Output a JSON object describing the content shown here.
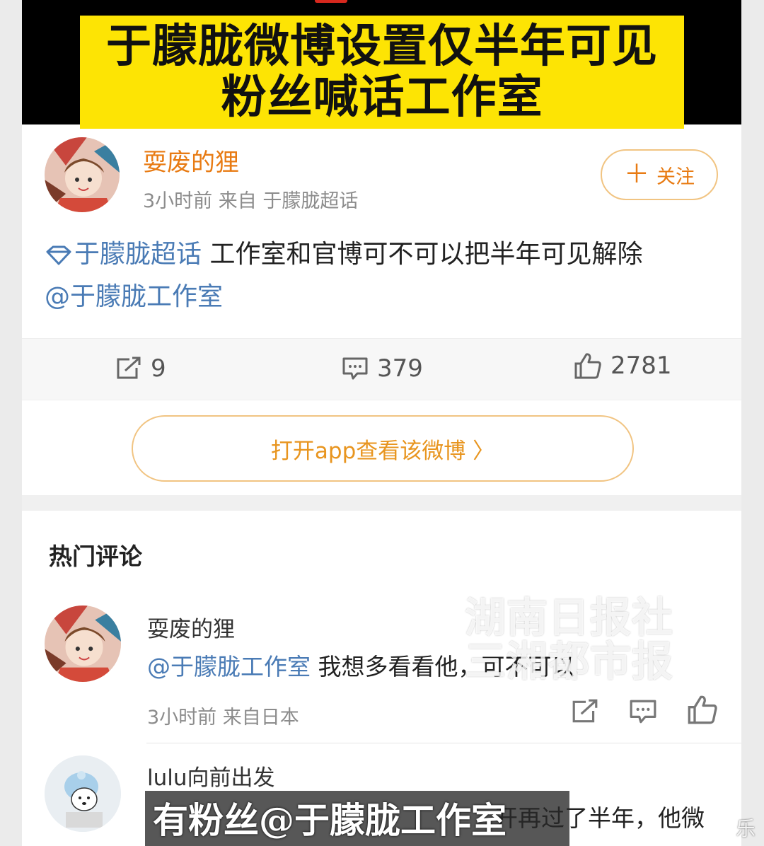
{
  "banner": {
    "line1": "于朦胧微博设置仅半年可见",
    "line2": "粉丝喊话工作室"
  },
  "post": {
    "user": "耍废的狸",
    "meta": "3小时前  来自 于朦胧超话",
    "follow_label": "关注",
    "topic": "于朦胧超话",
    "text": " 工作室和官博可不可以把半年可见解除",
    "mention": "@于朦胧工作室",
    "reposts": "9",
    "comments": "379",
    "likes": "2781",
    "open_app_label": "打开app查看该微博 〉"
  },
  "comments_section": {
    "title": "热门评论",
    "items": [
      {
        "user": "耍废的狸",
        "mention": "@于朦胧工作室",
        "text": " 我想多看看他，可不可以",
        "meta": "3小时前 来自日本"
      },
      {
        "user": "lulu向前出发",
        "text": "开再过了半年，他微"
      }
    ]
  },
  "overlays": {
    "watermark_line1": "湖南日报社",
    "watermark_line2": "三湘都市报",
    "subtitle": "有粉丝@于朦胧工作室",
    "corner": "乐"
  },
  "colors": {
    "banner_bg": "#fde404",
    "accent_orange": "#e87b13",
    "link_blue": "#4a7bb5"
  },
  "icons": [
    "repost-icon",
    "comment-icon",
    "like-icon",
    "diamond-topic-icon",
    "plus-icon",
    "chevron-right-icon"
  ]
}
